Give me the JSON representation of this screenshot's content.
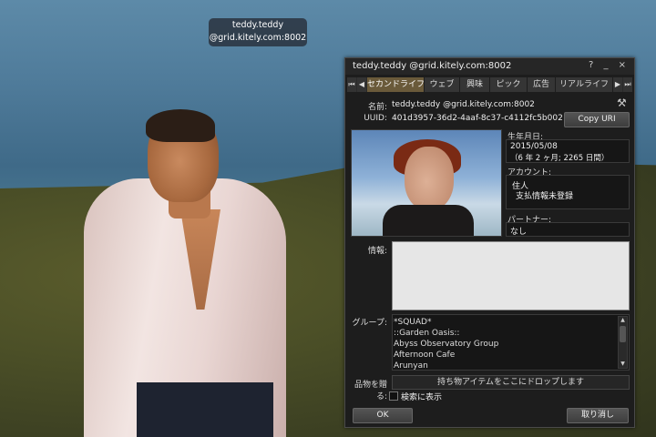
{
  "nametag": {
    "line1": "teddy.teddy",
    "line2": "@grid.kitely.com:8002"
  },
  "floater": {
    "title": "teddy.teddy @grid.kitely.com:8002",
    "title_icons": "? _ ×",
    "tabs": [
      "セカンドライフ",
      "ウェブ",
      "興味",
      "ピック",
      "広告",
      "リアルライフ"
    ],
    "active_tab": 0,
    "name_label": "名前:",
    "name_value": "teddy.teddy @grid.kitely.com:8002",
    "uuid_label": "UUID:",
    "uuid_value": "401d3957-36d2-4aaf-8c37-c4112fc5b002",
    "copy_uri_button": "Copy URI",
    "birthdate_label": "生年月日:",
    "birthdate_value": "2015/05/08",
    "birthdate_age": "（6 年 2 ヶ月; 2265 日間）",
    "account_label": "アカウント:",
    "account_type": "住人",
    "account_payment": "支払情報未登録",
    "partner_label": "パートナー:",
    "partner_value": "なし",
    "info_label": "情報:",
    "groups_label": "グループ:",
    "groups": [
      "*SQUAD*",
      "::Garden Oasis::",
      "Abyss Observatory Group",
      "Afternoon Cafe",
      "Arunyan"
    ],
    "give_item_label": "品物を贈る:",
    "drop_zone_text": "持ち物アイテムをここにドロップします",
    "show_in_search_label": "検索に表示",
    "ok_button": "OK",
    "cancel_button": "取り消し"
  }
}
